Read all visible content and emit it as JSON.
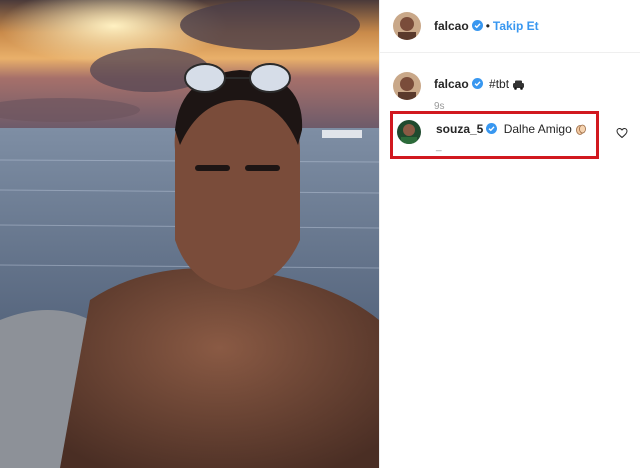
{
  "post": {
    "author": "falcao",
    "follow_label": "Takip Et",
    "separator": "•",
    "caption_username": "falcao",
    "caption_text": "#tbt",
    "caption_emoji": "car-emoji",
    "time_ago": "9s"
  },
  "comment": {
    "username": "souza_5",
    "text": "Dalhe Amigo",
    "emoji": "clapping-hands-emoji",
    "sub": "_"
  },
  "icons": {
    "verified": "verified-badge-icon",
    "like": "heart-icon"
  },
  "colors": {
    "link": "#3897f0",
    "verified": "#3897f0",
    "highlight_box": "#d1181f",
    "muted": "#999999"
  }
}
